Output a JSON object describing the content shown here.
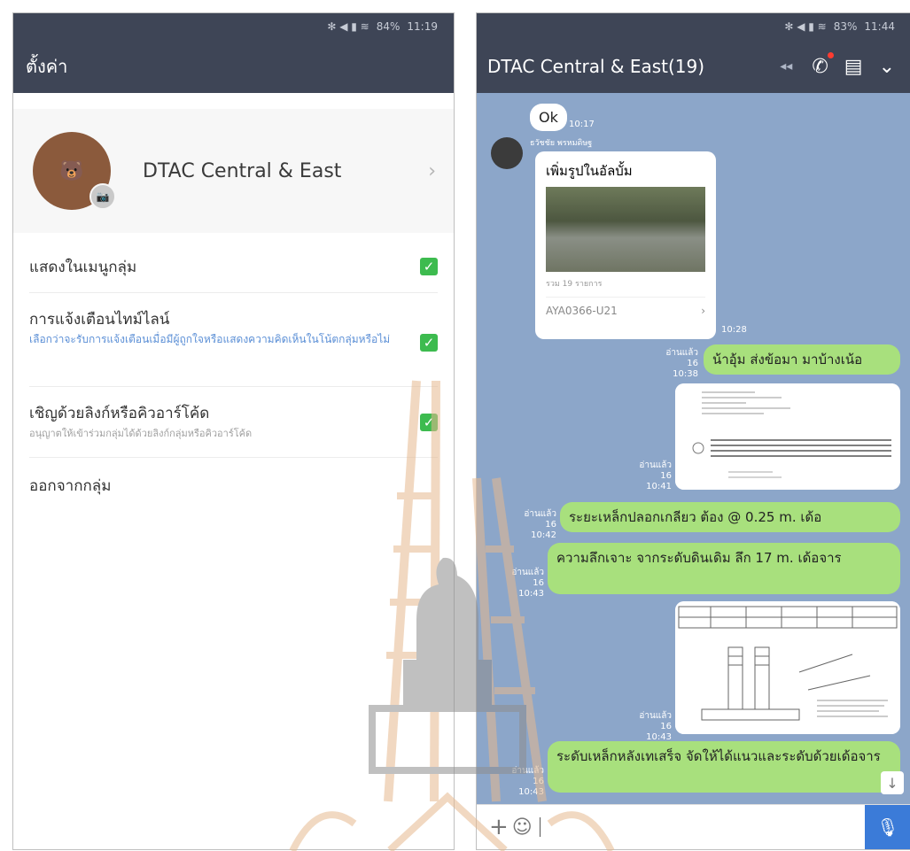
{
  "left": {
    "status": {
      "icons": "✻ ◀ ▮ ≋",
      "battery": "84%",
      "time": "11:19"
    },
    "title": "ตั้งค่า",
    "profile": {
      "name": "DTAC Central & East"
    },
    "settings": [
      {
        "title": "แสดงในเมนูกลุ่ม",
        "subtitle": "",
        "checked": true
      },
      {
        "title": "การแจ้งเตือนไทม์ไลน์",
        "subtitle": "เลือกว่าจะรับการแจ้งเตือนเมื่อมีผู้ถูกใจหรือแสดงความคิดเห็นในโน้ตกลุ่มหรือไม่",
        "checked": true
      },
      {
        "title": "เชิญด้วยลิงก์หรือคิวอาร์โค้ด",
        "subtitle": "อนุญาตให้เข้าร่วมกลุ่มได้ด้วยลิงก์กลุ่มหรือคิวอาร์โค้ด",
        "checked": true
      },
      {
        "title": "ออกจากกลุ่ม",
        "subtitle": "",
        "checked": false
      }
    ]
  },
  "right": {
    "status": {
      "icons": "✻ ◀ ▮ ≋",
      "battery": "83%",
      "time": "11:44"
    },
    "chat_title": "DTAC Central & East(19)",
    "messages": [
      {
        "type": "in-text",
        "text": "Ok",
        "time": "10:17"
      },
      {
        "type": "album",
        "sender": "ธวัชชัย พรหมดิษฐ",
        "title": "เพิ่มรูปในอัลบั้ม",
        "count": "รวม 19 รายการ",
        "album_name": "AYA0366-U21",
        "time": "10:28"
      },
      {
        "type": "out-text",
        "text": "น้าอุ้ม ส่งข้อมา มาบ้างเน้อ",
        "read": "อ่านแล้ว 16",
        "time": "10:38"
      },
      {
        "type": "out-image",
        "read": "อ่านแล้ว 16",
        "time": "10:41"
      },
      {
        "type": "out-text",
        "text": "ระยะเหล็กปลอกเกลียว ต้อง @ 0.25 m.  เด้อ",
        "read": "อ่านแล้ว 16",
        "time": "10:42"
      },
      {
        "type": "out-text",
        "text": "ความลึกเจาะ จากระดับดินเดิม ลึก 17  m. เด้อจาร",
        "read": "อ่านแล้ว 16",
        "time": "10:43"
      },
      {
        "type": "out-image",
        "read": "อ่านแล้ว 16",
        "time": "10:43"
      },
      {
        "type": "out-text",
        "text": "ระดับเหล็กหลังเทเสร็จ จัดให้ได้แนวและระดับด้วยเด้อจาร",
        "read": "อ่านแล้ว 16",
        "time": "10:43"
      }
    ]
  },
  "colors": {
    "appbar": "#3e4556",
    "chat_bg": "#8ca6c9",
    "out_bubble": "#a8e07d",
    "check": "#3dbb4f",
    "mic": "#3b7bd8"
  }
}
